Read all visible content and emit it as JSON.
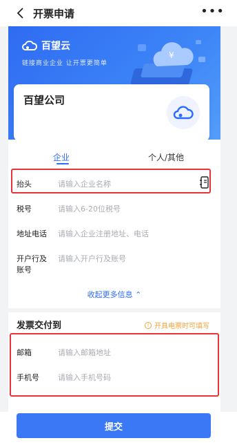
{
  "header": {
    "title": "开票申请",
    "more": "•••"
  },
  "banner": {
    "brand": "百望云",
    "slogan": "链接商业企业 让开票更简单"
  },
  "company": {
    "name": "百望公司"
  },
  "tabs": [
    {
      "label": "企业",
      "active": true
    },
    {
      "label": "个人/其他",
      "active": false
    }
  ],
  "fields": [
    {
      "label": "抬头",
      "placeholder": "请输入企业名称"
    },
    {
      "label": "税号",
      "placeholder": "请输入6-20位税号"
    },
    {
      "label": "地址电话",
      "placeholder": "请输入企业注册地址、电话"
    },
    {
      "label_line1": "开户行及",
      "label_line2": "账号",
      "placeholder": "请输入开户行及账号"
    }
  ],
  "collapse_label": "收起更多信息 ⌃",
  "delivery": {
    "title": "发票交付到",
    "note": "开具电票时可填写",
    "fields": [
      {
        "label": "邮箱",
        "placeholder": "请输入邮箱地址"
      },
      {
        "label": "手机号",
        "placeholder": "请输入手机号码"
      }
    ]
  },
  "submit_label": "提交",
  "colors": {
    "accent": "#2b6bff",
    "highlight": "#e8323a",
    "note": "#f0a33a"
  }
}
